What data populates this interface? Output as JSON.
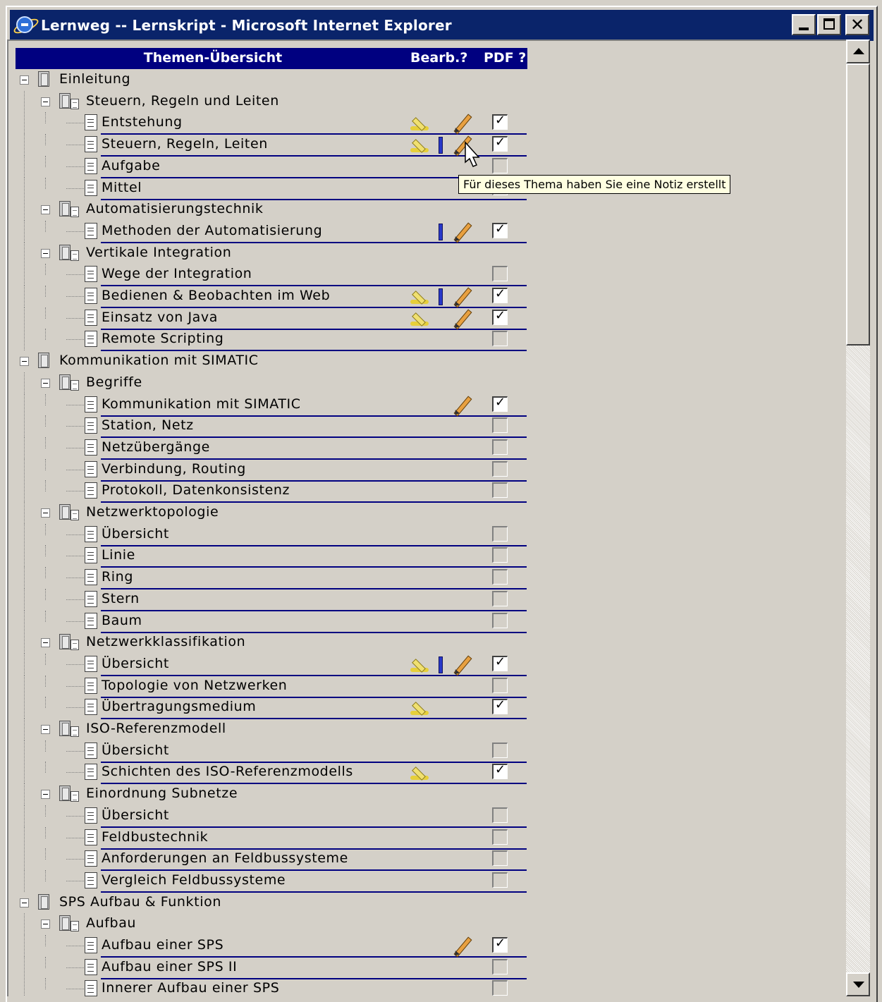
{
  "window": {
    "title": "Lernweg -- Lernskript - Microsoft Internet Explorer"
  },
  "header": {
    "topics": "Themen-Übersicht",
    "edit": "Bearb.?",
    "pdf": "PDF ?"
  },
  "tooltip": "Für dieses Thema haben Sie eine Notiz erstellt",
  "tree": [
    {
      "label": "Einleitung",
      "level": 0
    },
    {
      "label": "Steuern, Regeln und Leiten",
      "level": 1
    },
    {
      "label": "Entstehung",
      "level": 2,
      "highlight": true,
      "bar": false,
      "pencil": true,
      "pdf": true
    },
    {
      "label": "Steuern, Regeln, Leiten",
      "level": 2,
      "highlight": true,
      "bar": true,
      "pencil": true,
      "pdf": true
    },
    {
      "label": "Aufgabe",
      "level": 2,
      "highlight": false,
      "bar": false,
      "pencil": false,
      "pdf": false
    },
    {
      "label": "Mittel",
      "level": 2,
      "highlight": false,
      "bar": false,
      "pencil": false,
      "pdf": false
    },
    {
      "label": "Automatisierungstechnik",
      "level": 1
    },
    {
      "label": "Methoden der Automatisierung",
      "level": 2,
      "highlight": false,
      "bar": true,
      "pencil": true,
      "pdf": true
    },
    {
      "label": "Vertikale Integration",
      "level": 1
    },
    {
      "label": "Wege der Integration",
      "level": 2,
      "highlight": false,
      "bar": false,
      "pencil": false,
      "pdf": false
    },
    {
      "label": "Bedienen & Beobachten im Web",
      "level": 2,
      "highlight": true,
      "bar": true,
      "pencil": true,
      "pdf": true
    },
    {
      "label": "Einsatz von Java",
      "level": 2,
      "highlight": true,
      "bar": false,
      "pencil": true,
      "pdf": true
    },
    {
      "label": "Remote Scripting",
      "level": 2,
      "highlight": false,
      "bar": false,
      "pencil": false,
      "pdf": false
    },
    {
      "label": "Kommunikation mit SIMATIC",
      "level": 0
    },
    {
      "label": "Begriffe",
      "level": 1
    },
    {
      "label": "Kommunikation mit SIMATIC",
      "level": 2,
      "highlight": false,
      "bar": false,
      "pencil": true,
      "pdf": true
    },
    {
      "label": "Station, Netz",
      "level": 2,
      "highlight": false,
      "bar": false,
      "pencil": false,
      "pdf": false
    },
    {
      "label": "Netzübergänge",
      "level": 2,
      "highlight": false,
      "bar": false,
      "pencil": false,
      "pdf": false
    },
    {
      "label": "Verbindung, Routing",
      "level": 2,
      "highlight": false,
      "bar": false,
      "pencil": false,
      "pdf": false
    },
    {
      "label": "Protokoll, Datenkonsistenz",
      "level": 2,
      "highlight": false,
      "bar": false,
      "pencil": false,
      "pdf": false
    },
    {
      "label": "Netzwerktopologie",
      "level": 1
    },
    {
      "label": "Übersicht",
      "level": 2,
      "highlight": false,
      "bar": false,
      "pencil": false,
      "pdf": false
    },
    {
      "label": "Linie",
      "level": 2,
      "highlight": false,
      "bar": false,
      "pencil": false,
      "pdf": false
    },
    {
      "label": "Ring",
      "level": 2,
      "highlight": false,
      "bar": false,
      "pencil": false,
      "pdf": false
    },
    {
      "label": "Stern",
      "level": 2,
      "highlight": false,
      "bar": false,
      "pencil": false,
      "pdf": false
    },
    {
      "label": "Baum",
      "level": 2,
      "highlight": false,
      "bar": false,
      "pencil": false,
      "pdf": false
    },
    {
      "label": "Netzwerkklassifikation",
      "level": 1
    },
    {
      "label": "Übersicht",
      "level": 2,
      "highlight": true,
      "bar": true,
      "pencil": true,
      "pdf": true
    },
    {
      "label": "Topologie von Netzwerken",
      "level": 2,
      "highlight": false,
      "bar": false,
      "pencil": false,
      "pdf": false
    },
    {
      "label": "Übertragungsmedium",
      "level": 2,
      "highlight": true,
      "bar": false,
      "pencil": false,
      "pdf": true
    },
    {
      "label": "ISO-Referenzmodell",
      "level": 1
    },
    {
      "label": "Übersicht",
      "level": 2,
      "highlight": false,
      "bar": false,
      "pencil": false,
      "pdf": false
    },
    {
      "label": "Schichten des ISO-Referenzmodells",
      "level": 2,
      "highlight": true,
      "bar": false,
      "pencil": false,
      "pdf": true
    },
    {
      "label": "Einordnung Subnetze",
      "level": 1
    },
    {
      "label": "Übersicht",
      "level": 2,
      "highlight": false,
      "bar": false,
      "pencil": false,
      "pdf": false
    },
    {
      "label": "Feldbustechnik",
      "level": 2,
      "highlight": false,
      "bar": false,
      "pencil": false,
      "pdf": false
    },
    {
      "label": "Anforderungen an Feldbussysteme",
      "level": 2,
      "highlight": false,
      "bar": false,
      "pencil": false,
      "pdf": false
    },
    {
      "label": "Vergleich Feldbussysteme",
      "level": 2,
      "highlight": false,
      "bar": false,
      "pencil": false,
      "pdf": false
    },
    {
      "label": "SPS Aufbau & Funktion",
      "level": 0
    },
    {
      "label": "Aufbau",
      "level": 1
    },
    {
      "label": "Aufbau einer SPS",
      "level": 2,
      "highlight": false,
      "bar": false,
      "pencil": true,
      "pdf": true
    },
    {
      "label": "Aufbau einer SPS II",
      "level": 2,
      "highlight": false,
      "bar": false,
      "pencil": false,
      "pdf": false
    },
    {
      "label": "Innerer Aufbau einer SPS",
      "level": 2,
      "highlight": false,
      "bar": false,
      "pencil": false,
      "pdf": false
    }
  ]
}
